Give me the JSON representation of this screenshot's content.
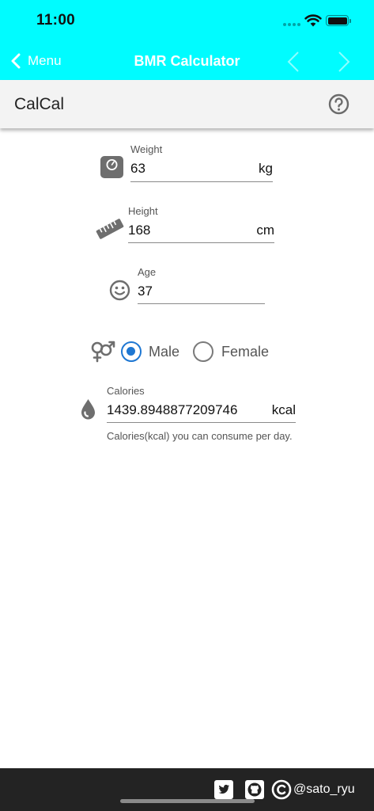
{
  "status_bar": {
    "time": "11:00"
  },
  "nav": {
    "back_label": "Menu",
    "title": "BMR Calculator",
    "prev_icon": "chevron-left-icon",
    "next_icon": "chevron-right-icon"
  },
  "app": {
    "brand": "CalCal",
    "help_icon": "question-circle-icon"
  },
  "form": {
    "weight": {
      "label": "Weight",
      "value": "63",
      "unit": "kg",
      "icon": "scale-icon"
    },
    "height": {
      "label": "Height",
      "value": "168",
      "unit": "cm",
      "icon": "ruler-icon"
    },
    "age": {
      "label": "Age",
      "value": "37",
      "icon": "smiley-icon"
    },
    "gender": {
      "icon": "gender-icon",
      "options": [
        {
          "label": "Male",
          "selected": true
        },
        {
          "label": "Female",
          "selected": false
        }
      ]
    },
    "calories": {
      "label": "Calories",
      "value": "1439.8948877209746",
      "unit": "kcal",
      "hint": "Calories(kcal) you can consume per day.",
      "icon": "drop-icon"
    }
  },
  "footer": {
    "credit": "@sato_ryu"
  },
  "colors": {
    "accent": "#00fcff",
    "radio": "#1e77d2",
    "footer": "#232323"
  }
}
